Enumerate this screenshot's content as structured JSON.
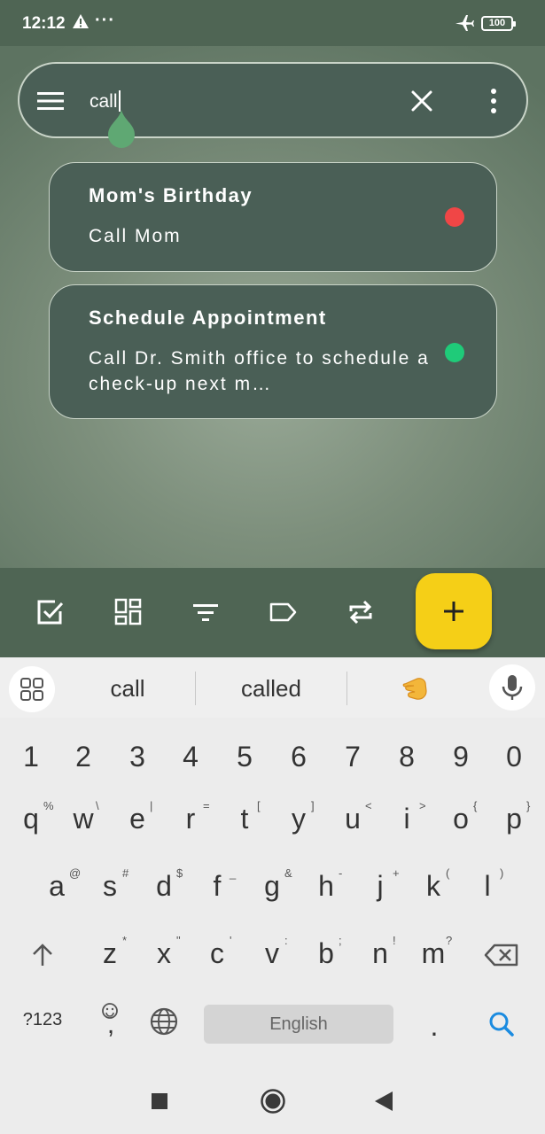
{
  "status": {
    "time": "12:12",
    "dots": "···",
    "battery": "100"
  },
  "search": {
    "query": "call"
  },
  "notes": [
    {
      "title": "Mom's Birthday",
      "body": "Call Mom",
      "dot_color": "#f04646"
    },
    {
      "title": "Schedule Appointment",
      "body": "Call Dr. Smith office to schedule a check-up next m…",
      "dot_color": "#1fcb79"
    }
  ],
  "toolbar": {
    "icons": [
      "checkbox-icon",
      "grid-view-icon",
      "filter-icon",
      "label-icon",
      "repeat-icon"
    ],
    "fab_label": "+",
    "fab_color": "#f5cf17"
  },
  "keyboard": {
    "suggestions": [
      "call",
      "called"
    ],
    "emoji_suggestion": "🫵",
    "number_row": [
      "1",
      "2",
      "3",
      "4",
      "5",
      "6",
      "7",
      "8",
      "9",
      "0"
    ],
    "row1": [
      "q",
      "w",
      "e",
      "r",
      "t",
      "y",
      "u",
      "i",
      "o",
      "p"
    ],
    "row1_sup": [
      "%",
      "\\",
      "|",
      "=",
      "[",
      "]",
      "<",
      ">",
      "{",
      "}"
    ],
    "row2": [
      "a",
      "s",
      "d",
      "f",
      "g",
      "h",
      "j",
      "k",
      "l"
    ],
    "row2_sup": [
      "@",
      "#",
      "$",
      "_",
      "&",
      "-",
      "+",
      "(",
      ")"
    ],
    "row3": [
      "z",
      "x",
      "c",
      "v",
      "b",
      "n",
      "m"
    ],
    "row3_sup": [
      "*",
      "\"",
      "'",
      ":",
      ";",
      "!",
      "?"
    ],
    "symbols_key": "?123",
    "comma_key": ",",
    "period_key": ".",
    "space_label": "English",
    "accent_color": "#1a8be0"
  }
}
